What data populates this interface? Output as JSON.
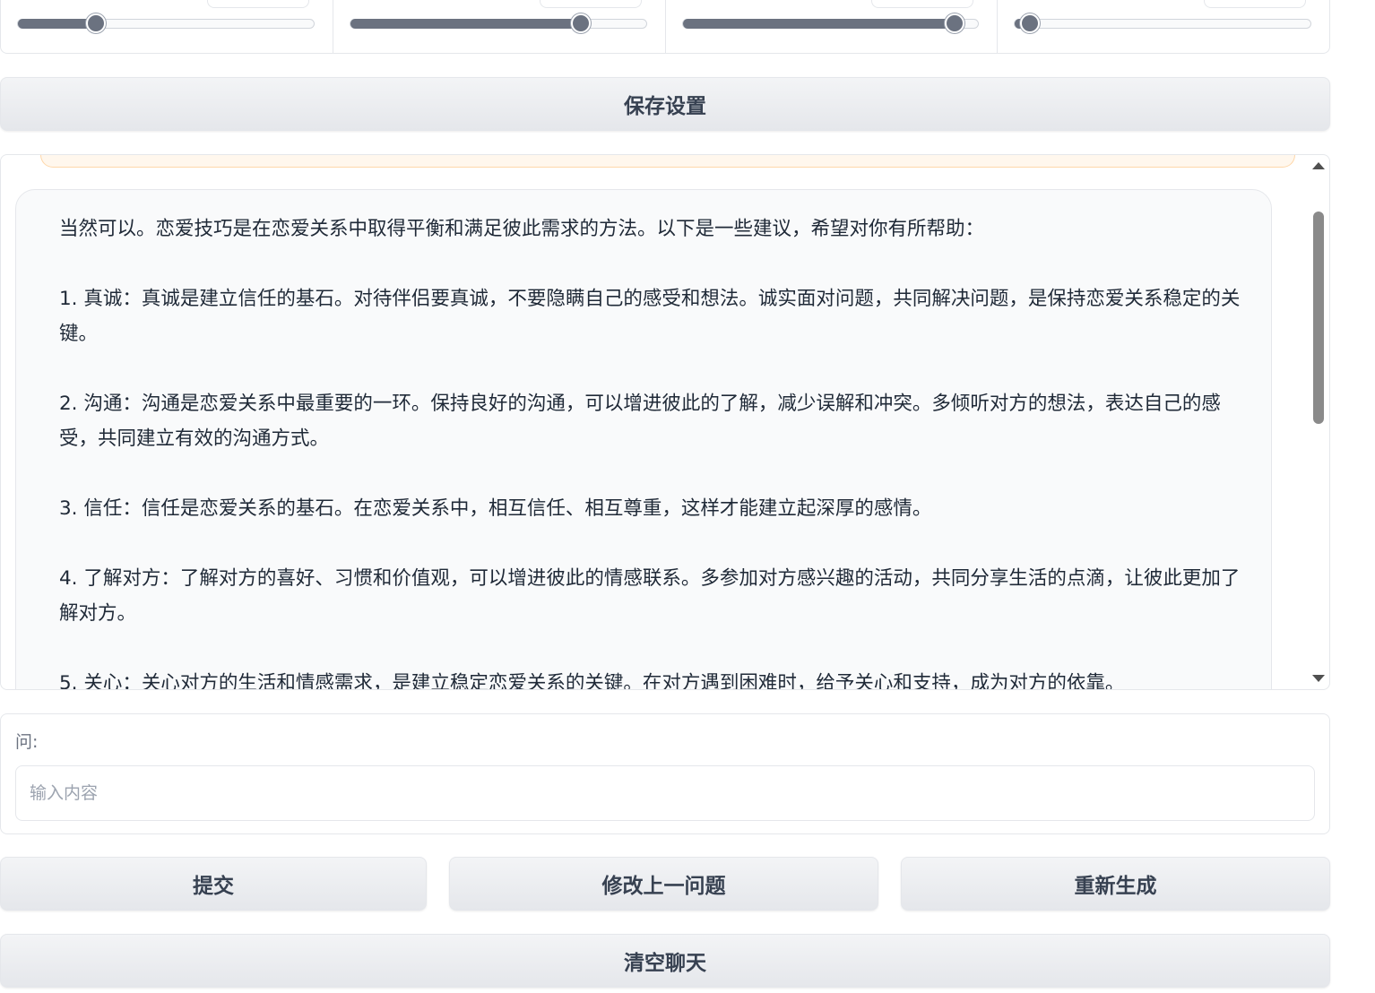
{
  "sliders": [
    {
      "value_fraction": 0.265
    },
    {
      "value_fraction": 0.78
    },
    {
      "value_fraction": 0.92
    },
    {
      "value_fraction": 0.05
    }
  ],
  "save_button_label": "保存设置",
  "chat": {
    "bot_message_paragraphs": [
      "当然可以。恋爱技巧是在恋爱关系中取得平衡和满足彼此需求的方法。以下是一些建议，希望对你有所帮助：",
      "1. 真诚：真诚是建立信任的基石。对待伴侣要真诚，不要隐瞒自己的感受和想法。诚实面对问题，共同解决问题，是保持恋爱关系稳定的关键。",
      "2. 沟通：沟通是恋爱关系中最重要的一环。保持良好的沟通，可以增进彼此的了解，减少误解和冲突。多倾听对方的想法，表达自己的感受，共同建立有效的沟通方式。",
      "3. 信任：信任是恋爱关系的基石。在恋爱关系中，相互信任、相互尊重，这样才能建立起深厚的感情。",
      "4. 了解对方：了解对方的喜好、习惯和价值观，可以增进彼此的情感联系。多参加对方感兴趣的活动，共同分享生活的点滴，让彼此更加了解对方。",
      "5. 关心：关心对方的生活和情感需求，是建立稳定恋爱关系的关键。在对方遇到困难时，给予关心和支持，成为对方的依靠。"
    ]
  },
  "question": {
    "label": "问:",
    "placeholder": "输入内容",
    "value": ""
  },
  "actions": {
    "submit_label": "提交",
    "edit_last_label": "修改上一问题",
    "regenerate_label": "重新生成",
    "clear_chat_label": "清空聊天"
  },
  "colors": {
    "slider_fill": "#6b7280",
    "button_bg": "#e5e7eb",
    "bot_bubble_bg": "#f9fafb",
    "user_bubble_border": "#fed7aa"
  }
}
